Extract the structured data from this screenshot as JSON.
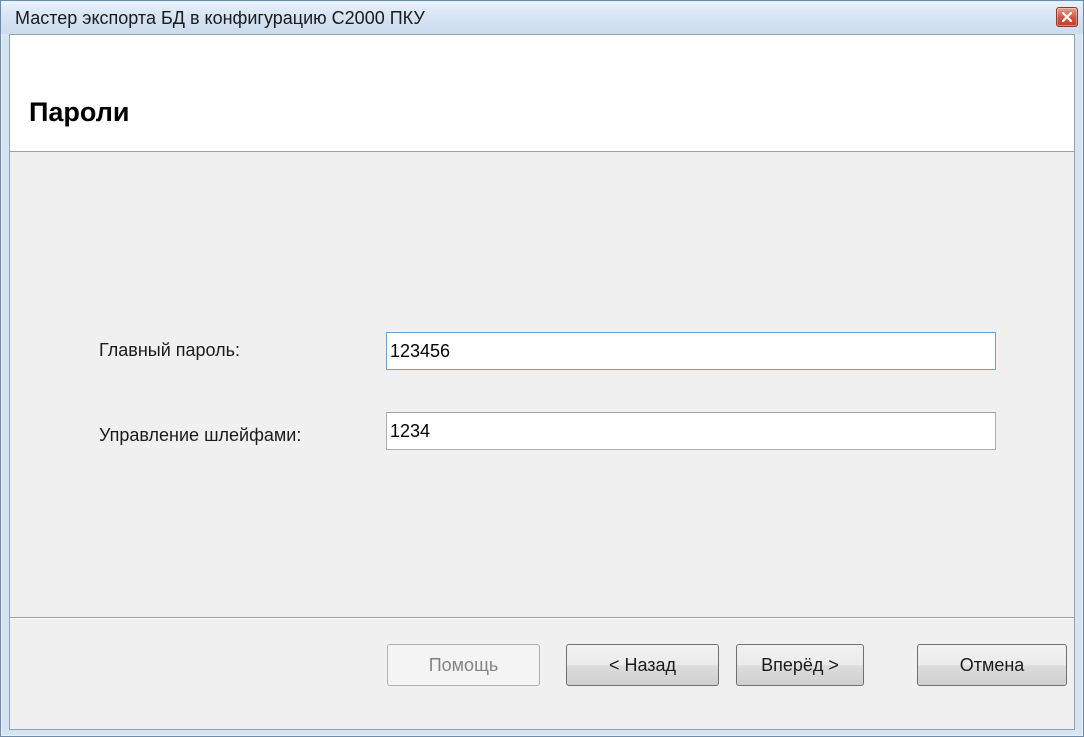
{
  "window": {
    "title": "Мастер экспорта БД в конфигурацию С2000 ПКУ",
    "close_icon": "close-icon"
  },
  "page": {
    "heading": "Пароли"
  },
  "form": {
    "main_password": {
      "label": "Главный пароль:",
      "value": "123456"
    },
    "loop_control": {
      "label": "Управление шлейфами:",
      "value": "1234"
    }
  },
  "buttons": {
    "help": "Помощь",
    "back": "< Назад",
    "next": "Вперёд >",
    "cancel": "Отмена"
  }
}
